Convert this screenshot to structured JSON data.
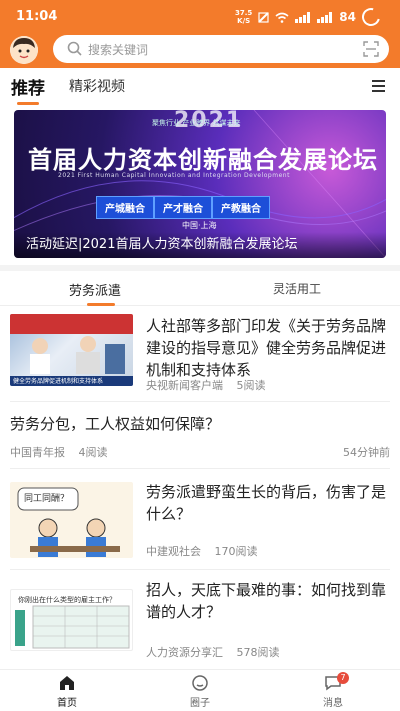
{
  "status_bar": {
    "time": "11:04",
    "network_speed": "37.5",
    "network_unit": "K/S",
    "battery": "84"
  },
  "search": {
    "placeholder": "搜索关键词"
  },
  "channels": [
    {
      "label": "推荐",
      "active": true
    },
    {
      "label": "精彩视频",
      "active": false
    }
  ],
  "banner": {
    "year": "2021",
    "tagline": "聚焦行业 产业跨界 共谋未来",
    "headline": "首届人力资本创新融合发展论坛",
    "subtitle_en": "2021 First Human Capital Innovation and Integration Development",
    "pills": [
      "产城融合",
      "产才融合",
      "产教融合"
    ],
    "location": "中国·上海",
    "caption": "活动延迟|2021首届人力资本创新融合发展论坛"
  },
  "subtabs": [
    {
      "label": "劳务派遣",
      "active": true
    },
    {
      "label": "灵活用工",
      "active": false
    }
  ],
  "articles": [
    {
      "title": "人社部等多部门印发《关于劳务品牌建设的指导意见》健全劳务品牌促进机制和支持体系",
      "source": "央视新闻客户端",
      "reads": "5阅读",
      "thumb_caption": "健全劳务品牌促进机制和支持体系"
    },
    {
      "title": "劳务分包，工人权益如何保障？",
      "source": "中国青年报",
      "reads": "4阅读",
      "time": "54分钟前"
    },
    {
      "title": "劳务派遣野蛮生长的背后，伤害了是什么？",
      "source": "中建观社会",
      "reads": "170阅读",
      "thumb_caption": "同工同酬？"
    },
    {
      "title": "招人，天底下最难的事：如何找到靠谱的人才？",
      "source": "人力资源分享汇",
      "reads": "578阅读",
      "thumb_caption": "你刚出在什么类型的雇主工作？"
    }
  ],
  "bottom_nav": [
    {
      "label": "首页",
      "icon": "home-icon",
      "active": true
    },
    {
      "label": "圈子",
      "icon": "circle-icon",
      "active": false
    },
    {
      "label": "消息",
      "icon": "message-icon",
      "active": false,
      "badge": "7"
    }
  ],
  "colors": {
    "accent": "#f37b2b",
    "badge": "#e74c3c"
  }
}
